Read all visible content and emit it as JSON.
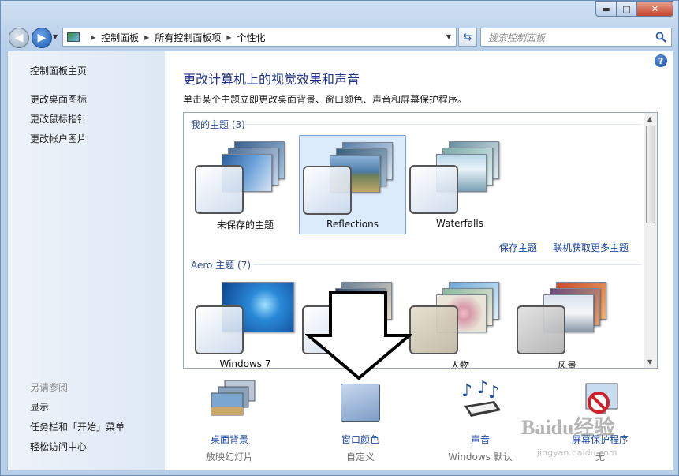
{
  "window": {
    "caption": {
      "minimize": "▬",
      "maximize": "□",
      "close": "✕"
    }
  },
  "address_bar": {
    "crumbs": [
      "控制面板",
      "所有控制面板项",
      "个性化"
    ],
    "search_placeholder": "搜索控制面板"
  },
  "sidebar": {
    "home": "控制面板主页",
    "links": [
      "更改桌面图标",
      "更改鼠标指针",
      "更改帐户图片"
    ],
    "see_also_heading": "另请参阅",
    "see_also": [
      "显示",
      "任务栏和「开始」菜单",
      "轻松访问中心"
    ]
  },
  "main": {
    "title": "更改计算机上的视觉效果和声音",
    "description": "单击某个主题立即更改桌面背景、窗口颜色、声音和屏幕保护程序。",
    "my_themes_label": "我的主题 (3)",
    "my_themes": [
      {
        "name": "未保存的主题",
        "selected": false
      },
      {
        "name": "Reflections",
        "selected": true
      },
      {
        "name": "Waterfalls",
        "selected": false
      }
    ],
    "save_theme": "保存主题",
    "get_more_themes": "联机获取更多主题",
    "aero_label": "Aero 主题 (7)",
    "aero_themes": [
      {
        "name": "Windows 7"
      },
      {
        "name": ""
      },
      {
        "name": "人物"
      },
      {
        "name": "风景"
      }
    ],
    "bottom_items": [
      {
        "label": "桌面背景",
        "sub": "放映幻灯片",
        "icon": "desktop-background-icon"
      },
      {
        "label": "窗口颜色",
        "sub": "自定义",
        "icon": "window-color-icon"
      },
      {
        "label": "声音",
        "sub": "Windows 默认",
        "icon": "sounds-icon"
      },
      {
        "label": "屏幕保护程序",
        "sub": "无",
        "icon": "screen-saver-icon"
      }
    ]
  },
  "watermark": {
    "text": "Baidu经验",
    "url_text": "jingyan.baidu.com"
  }
}
